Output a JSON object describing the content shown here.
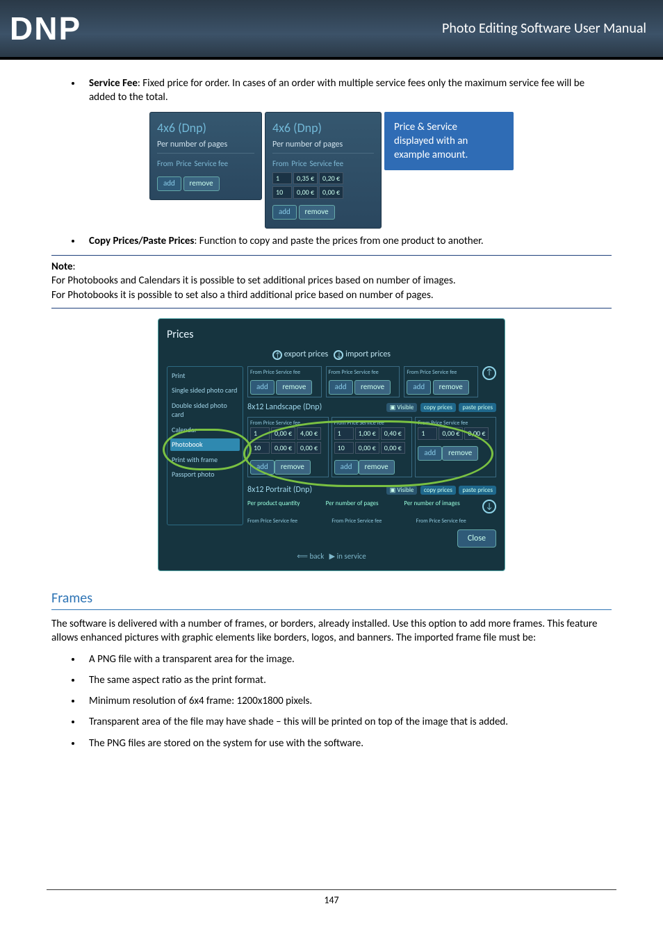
{
  "header": {
    "logo_text": "DNP",
    "doc_title": "Photo Editing Software User Manual"
  },
  "bullets_top": {
    "service_fee_label": "Service Fee",
    "service_fee_text": ": Fixed price for order. In cases of an order with multiple service fees only the maximum service fee will be added to the total.",
    "copy_paste_label": "Copy Prices/Paste Prices",
    "copy_paste_text": ": Function to copy and paste the prices from one product to another."
  },
  "figure1": {
    "panel_left": {
      "title": "4x6 (Dnp)",
      "subtitle": "Per number of pages",
      "th_from": "From",
      "th_price": "Price",
      "th_service": "Service fee",
      "btn_add": "add",
      "btn_remove": "remove"
    },
    "panel_mid": {
      "title": "4x6 (Dnp)",
      "subtitle": "Per number of pages",
      "th_from": "From",
      "th_price": "Price",
      "th_service": "Service fee",
      "row1_from": "1",
      "row1_price": "0,35 €",
      "row1_service": "0,20 €",
      "row2_from": "10",
      "row2_price": "0,00 €",
      "row2_service": "0,00 €",
      "btn_add": "add",
      "btn_remove": "remove"
    },
    "callout": {
      "l1": "Price & Service",
      "l2": "displayed with an",
      "l3": "example amount."
    }
  },
  "note": {
    "label": "Note",
    "line1": "For Photobooks and Calendars it is possible to set additional prices based on number of images.",
    "line2": "For Photobooks it is possible to set also a third additional price based on number of pages."
  },
  "bigpanel": {
    "title": "Prices",
    "export": "export prices",
    "import": "import prices",
    "side": {
      "i1": "Print",
      "i2": "Single sided photo card",
      "i3": "Double sided photo card",
      "i4": "Calendar",
      "i5": "Photobook",
      "i6": "Print with frame",
      "i7": "Passport photo"
    },
    "row1_title": "8x12 Landscape (Dnp)",
    "row2_title": "8x12 Portrait (Dnp)",
    "visible": "Visible",
    "copy": "copy prices",
    "paste": "paste prices",
    "per_q": "Per product quantity",
    "per_pages": "Per number of pages",
    "per_images": "Per number of images",
    "hdr_from": "From",
    "hdr_price": "Price",
    "hdr_svc": "Service fee",
    "v1a": "1",
    "v1b": "0,00 €",
    "v1c": "4,00 €",
    "v2a": "1",
    "v2b": "1,00 €",
    "v2c": "0,40 €",
    "v3a": "1",
    "v3b": "0,00 €",
    "v3c": "0,00 €",
    "v4a": "10",
    "v4b": "0,00 €",
    "v4c": "0,00 €",
    "v5a": "10",
    "v5b": "0,00 €",
    "v5c": "0,00 €",
    "btn_add": "add",
    "btn_remove": "remove",
    "close": "Close",
    "back": "back",
    "inservice": "in service"
  },
  "frames": {
    "heading": "Frames",
    "p1": "The software is delivered with a number of frames, or borders, already installed. Use this option to add more frames. This feature allows enhanced pictures with graphic elements like borders, logos, and banners. The imported frame file must be:",
    "b1": "A PNG file with a transparent area for the image.",
    "b2": "The same aspect ratio as the print format.",
    "b3": "Minimum resolution of 6x4 frame: 1200x1800 pixels.",
    "b4": "Transparent area of the file may have shade – this will be printed on top of the image that is added.",
    "b5": "The PNG files are stored on the system for use with the software."
  },
  "footer": {
    "page": "147"
  }
}
